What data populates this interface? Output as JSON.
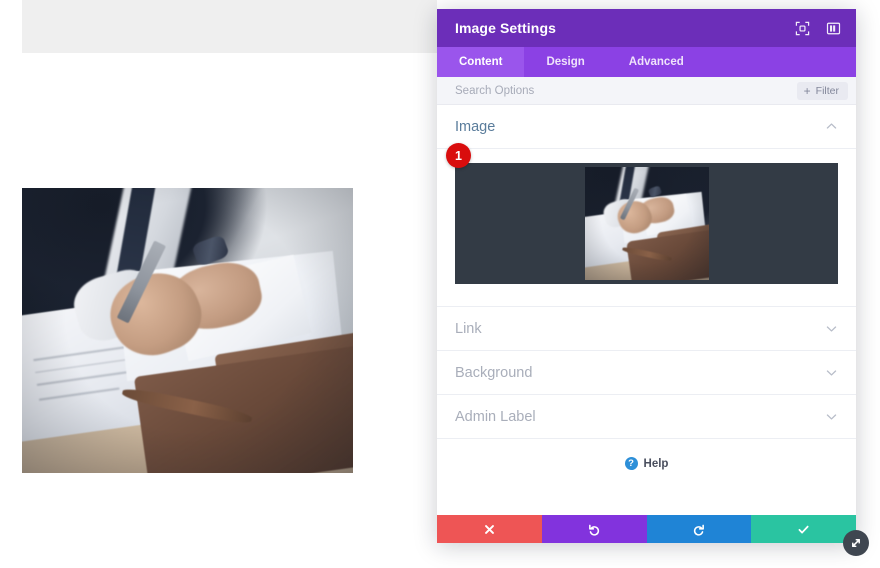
{
  "page": {
    "background_color": "#ffffff",
    "top_bar_color": "#efefef"
  },
  "canvas": {
    "photo_alt": "Businessman in suit signing documents on a desk with leather portfolio"
  },
  "modal": {
    "title": "Image Settings",
    "header_color": "#6c2eb9",
    "tabbar_color": "#8b41e4",
    "header_icons": [
      {
        "name": "fullscreen-icon",
        "label": "Expand"
      },
      {
        "name": "layout-icon",
        "label": "Change Layout"
      }
    ],
    "tabs": [
      {
        "label": "Content",
        "active": true
      },
      {
        "label": "Design",
        "active": false
      },
      {
        "label": "Advanced",
        "active": false
      }
    ],
    "search": {
      "value": "",
      "placeholder": "Search Options"
    },
    "filter": {
      "label": "Filter",
      "plus": "+"
    },
    "sections": [
      {
        "label": "Image",
        "open": true,
        "badge": "1"
      },
      {
        "label": "Link",
        "open": false
      },
      {
        "label": "Background",
        "open": false
      },
      {
        "label": "Admin Label",
        "open": false
      }
    ],
    "help": {
      "label": "Help",
      "icon_glyph": "?",
      "icon_color": "#2d8fd8"
    },
    "actions": [
      {
        "name": "cancel-button",
        "glyph": "close-icon",
        "color": "#ee5555"
      },
      {
        "name": "undo-button",
        "glyph": "undo-icon",
        "color": "#8233dd"
      },
      {
        "name": "redo-button",
        "glyph": "redo-icon",
        "color": "#1f84d6"
      },
      {
        "name": "save-button",
        "glyph": "check-icon",
        "color": "#2ac4a1"
      }
    ],
    "resize_handle": {
      "name": "resize-handle-icon"
    }
  }
}
